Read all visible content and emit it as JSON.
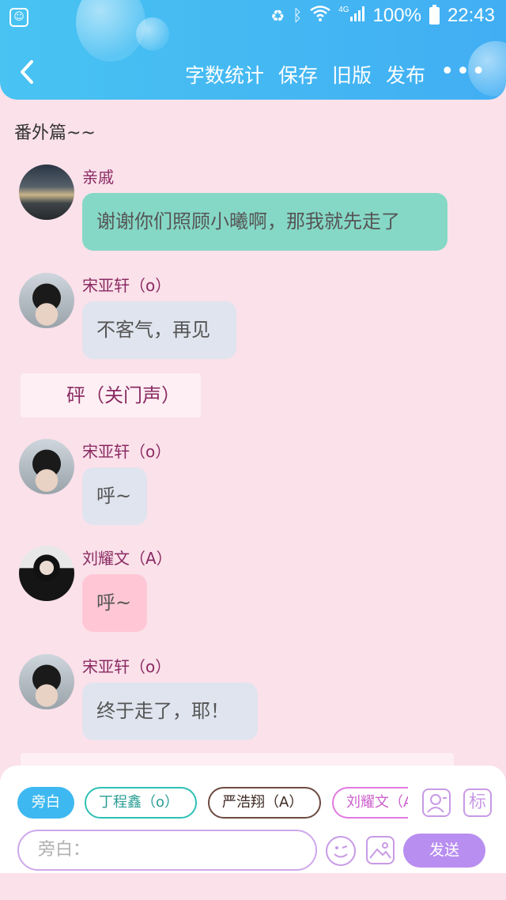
{
  "status_bar": {
    "battery": "100%",
    "time": "22:43",
    "network": "4G"
  },
  "toolbar": {
    "word_count": "字数统计",
    "save": "保存",
    "old_version": "旧版",
    "publish": "发布"
  },
  "chapter_title": "番外篇~~",
  "messages": [
    {
      "speaker": "亲戚",
      "text": "谢谢你们照顾小曦啊，那我就先走了",
      "style": "green"
    },
    {
      "speaker": "宋亚轩（o）",
      "text": "不客气，再见",
      "style": "grey"
    },
    {
      "speaker": "宋亚轩（o）",
      "text": "呼~",
      "style": "grey"
    },
    {
      "speaker": "刘耀文（A）",
      "text": "呼~",
      "style": "pink"
    },
    {
      "speaker": "宋亚轩（o）",
      "text": "终于走了，耶！",
      "style": "grey"
    }
  ],
  "narration": "砰（关门声）",
  "composer": {
    "roles": [
      {
        "label": "旁白",
        "active": true
      },
      {
        "label": "丁程鑫（o）",
        "active": false
      },
      {
        "label": "严浩翔（A）",
        "active": false
      },
      {
        "label": "刘耀文（A）",
        "active": false
      }
    ],
    "tag_button": "标",
    "input_placeholder": "旁白：",
    "send_label": "发送"
  },
  "colors": {
    "header": "#45b9f2",
    "background": "#fbe1ea",
    "speaker": "#8a2b63",
    "send": "#b88ef0"
  }
}
